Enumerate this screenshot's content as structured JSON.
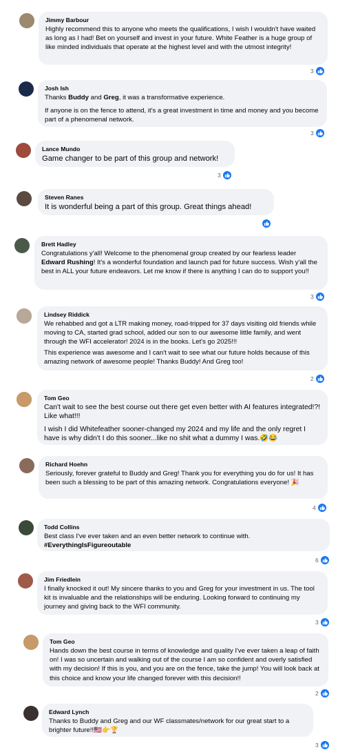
{
  "comments": [
    {
      "author": "Jimmy Barbour",
      "paragraphs": [
        "Highly recommend this to anyone who meets the qualifications, I wish I wouldn't have waited as long as I had! Bet on yourself and invest in your future. White Feather is a huge group of like minded individuals that operate at the highest level and with the utmost integrity!"
      ],
      "likes": "3",
      "avatar_color": "#9c8a6e"
    },
    {
      "author": "Josh Ish",
      "p1_a": "Thanks ",
      "p1_m1": "Buddy",
      "p1_b": " and ",
      "p1_m2": "Greg",
      "p1_c": ", it was a transformative experience.",
      "p2": "If anyone is on the fence to attend, it's a great investment in time and money and you become part of a phenomenal network.",
      "likes": "3",
      "avatar_color": "#1c2a4a"
    },
    {
      "author": "Lance Mundo",
      "paragraphs": [
        "Game changer to be part of this group and network!"
      ],
      "likes": "3",
      "avatar_color": "#a04a3c"
    },
    {
      "author": "Steven Ranes",
      "paragraphs": [
        "It is wonderful being a part of this group. Great things ahead!"
      ],
      "likes": "",
      "avatar_color": "#5a4a40"
    },
    {
      "author": "Brett Hadley",
      "p1_a": "Congratulations y'all! Welcome to the phenomenal group created by our fearless leader ",
      "p1_m1": "Edward Rushing",
      "p1_c": "! It's a wonderful foundation and launch pad for future success. Wish y'all the best in ALL your future endeavors. Let me know if there is anything I can do to support you!!",
      "likes": "3",
      "avatar_color": "#4a5a4a"
    },
    {
      "author": "Lindsey Riddick",
      "paragraphs": [
        "We rehabbed and got a LTR making money, road-tripped for 37 days visiting old friends while moving to CA, started grad school, added our son to our awesome little family, and went through the WFI accelerator! 2024 is in the books. Let's go 2025!!!",
        "This experience was awesome and I can't wait to see what our future holds because of this amazing network of awesome people! Thanks Buddy! And Greg too!"
      ],
      "likes": "2",
      "avatar_color": "#b8a898"
    },
    {
      "author": "Tom Geo",
      "paragraphs": [
        "Can't wait to see the best course out there get even better with AI features integrated!?! Like what!!!",
        "I wish I did Whitefeather sooner-changed my 2024 and my life and the only regret I have is why didn't I do this sooner...like no shit what a dummy I was.🤣😂"
      ],
      "likes": "",
      "avatar_color": "#c89a6a"
    },
    {
      "author": "Richard Hoehn",
      "paragraphs": [
        "Seriously, forever grateful to Buddy and Greg! Thank you for everything you do for us! It has been such a blessing to be part of this amazing network. Congratulations everyone! 🎉"
      ],
      "likes": "4",
      "avatar_color": "#8a6a5a"
    },
    {
      "author": "Todd Collins",
      "paragraphs": [
        "Best class I've ever taken and an even better network to continue with.",
        "#EverythingIsFigureoutable"
      ],
      "likes": "6",
      "avatar_color": "#3a4a3a"
    },
    {
      "author": "Jim Friedlein",
      "paragraphs": [
        "I finally knocked it out! My sincere thanks to you and Greg for your investment in us. The tool kit is invaluable and the relationships will be enduring. Looking forward to continuing my journey and giving back to the WFI community."
      ],
      "likes": "3",
      "avatar_color": "#a05a4a"
    },
    {
      "author": "Tom Geo",
      "paragraphs": [
        "Hands down the best course in terms of knowledge and quality I've ever taken a leap of faith on! I was so uncertain and walking out of the course I am so confident and overly satisfied with my decision! If this is you, and you are on the fence, take the jump! You will look back at this choice and know your life changed forever with this decision!!"
      ],
      "likes": "2",
      "avatar_color": "#c89a6a"
    },
    {
      "author": "Edward Lynch",
      "paragraphs": [
        "Thanks to Buddy and Greg and our WF classmates/network for our great start to a brighter future!!🇺🇸👉🏆"
      ],
      "likes": "3",
      "avatar_color": "#3a3030"
    }
  ],
  "colors": {
    "bubble": "#f0f2f5",
    "like_blue": "#1877f2",
    "meta_text": "#65676b"
  },
  "icons": {
    "reaction": "like-thumbs-up-icon"
  }
}
